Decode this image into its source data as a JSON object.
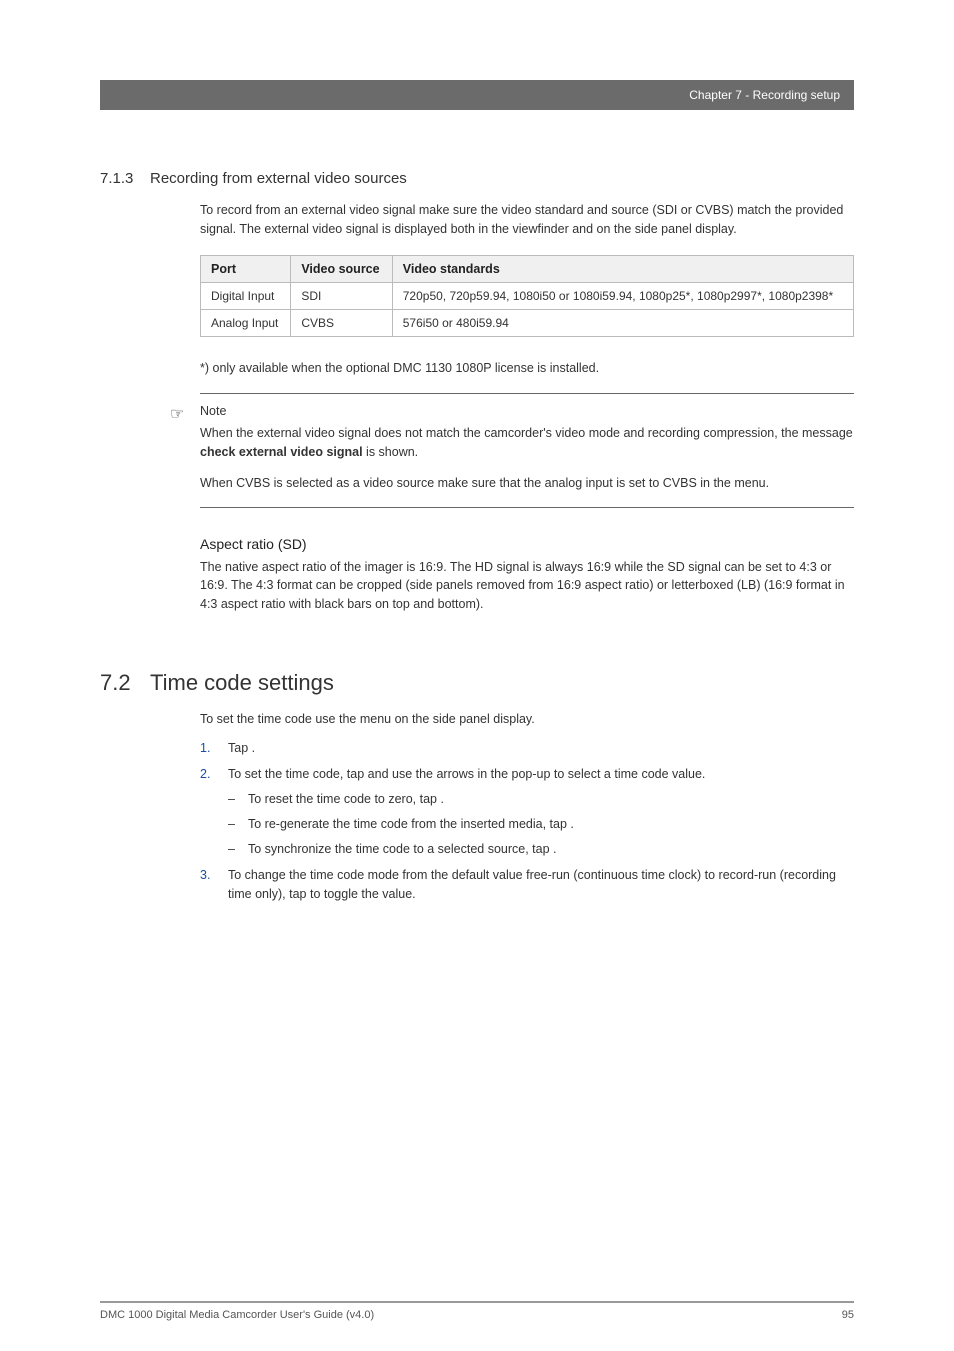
{
  "header": {
    "chapter": "Chapter 7 - Recording setup"
  },
  "section713": {
    "number": "7.1.3",
    "title": "Recording from external video sources",
    "intro": "To record from an external video signal make sure the video standard and source (SDI or CVBS) match the provided signal. The external video signal is displayed both in the viewfinder and on the side panel display.",
    "table": {
      "headers": [
        "Port",
        "Video source",
        "Video standards"
      ],
      "rows": [
        [
          "Digital Input",
          "SDI",
          "720p50, 720p59.94, 1080i50 or 1080i59.94, 1080p25*, 1080p2997*, 1080p2398*"
        ],
        [
          "Analog Input",
          "CVBS",
          "576i50 or 480i59.94"
        ]
      ]
    },
    "footnote": "*) only available when the optional DMC 1130 1080P license is installed.",
    "note": {
      "label": "Note",
      "text1_a": "When the external video signal does not match the camcorder's video mode and recording compression, the message ",
      "text1_bold": "check external video signal",
      "text1_b": " is shown.",
      "text2_a": "When CVBS is selected as a video source make sure that the analog input is set to CVBS in the ",
      "text2_b": " menu."
    },
    "aspect": {
      "heading": "Aspect ratio (SD)",
      "text": "The native aspect ratio of the imager is 16:9. The HD signal is always 16:9 while the SD signal can be set to 4:3 or 16:9. The 4:3 format can be cropped (side panels removed from 16:9 aspect ratio) or letterboxed (LB) (16:9 format in 4:3 aspect ratio with black bars on top and bottom)."
    }
  },
  "section72": {
    "number": "7.2",
    "title": "Time code settings",
    "intro_a": "To set the time code use the ",
    "intro_b": " menu on the side panel display.",
    "steps": {
      "s1_a": "Tap ",
      "s1_b": ".",
      "s2_a": "To set the time code, tap ",
      "s2_b": " and use the arrows in the pop-up to select a time code value.",
      "s2_sub1_a": "To reset the time code to zero, tap ",
      "s2_sub1_b": ".",
      "s2_sub2_a": "To re-generate the time code from the inserted media, tap ",
      "s2_sub2_b": ".",
      "s2_sub3_a": "To synchronize the time code to a selected source, tap ",
      "s2_sub3_b": ".",
      "s3_a": "To change the time code mode from the default value free-run (continuous time clock) to record-run (recording time only), tap ",
      "s3_b": " to toggle the value."
    }
  },
  "footer": {
    "doc": "DMC 1000 Digital Media Camcorder User's Guide (v4.0)",
    "page": "95"
  }
}
